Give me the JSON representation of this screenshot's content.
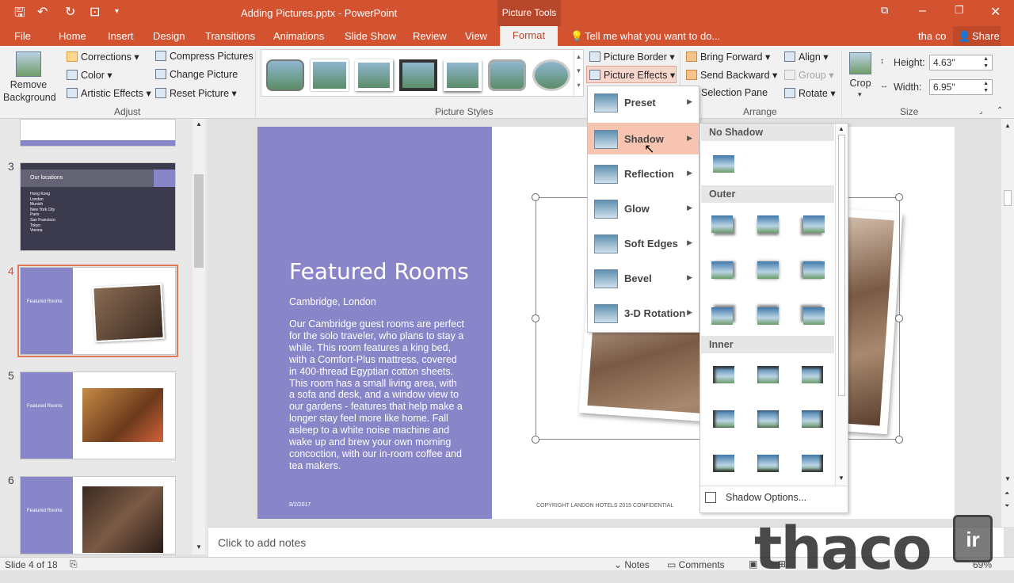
{
  "titlebar": {
    "title": "Adding Pictures.pptx - PowerPoint",
    "context": "Picture Tools"
  },
  "tabs": {
    "file": "File",
    "home": "Home",
    "insert": "Insert",
    "design": "Design",
    "transitions": "Transitions",
    "animations": "Animations",
    "slideshow": "Slide Show",
    "review": "Review",
    "view": "View",
    "format": "Format",
    "tellme": "Tell me what you want to do...",
    "user": "tha co",
    "share": "Share"
  },
  "ribbon": {
    "remove_bg": "Remove Background",
    "corrections": "Corrections",
    "color": "Color",
    "artistic": "Artistic Effects",
    "compress": "Compress Pictures",
    "change": "Change Picture",
    "reset": "Reset Picture",
    "adjust": "Adjust",
    "border": "Picture Border",
    "effects": "Picture Effects",
    "styles": "Picture Styles",
    "bring_forward": "Bring Forward",
    "send_backward": "Send Backward",
    "selection_pane": "Selection Pane",
    "align": "Align",
    "group": "Group",
    "rotate": "Rotate",
    "arrange": "Arrange",
    "crop": "Crop",
    "height_label": "Height:",
    "height_value": "4.63\"",
    "width_label": "Width:",
    "width_value": "6.95\"",
    "size": "Size"
  },
  "effects_menu": [
    "Preset",
    "Shadow",
    "Reflection",
    "Glow",
    "Soft Edges",
    "Bevel",
    "3-D Rotation"
  ],
  "shadow_menu": {
    "no_shadow": "No Shadow",
    "outer": "Outer",
    "inner": "Inner",
    "options": "Shadow Options..."
  },
  "slides": [
    {
      "num": "3",
      "title": "Our locations",
      "items": [
        "Hong Kong",
        "London",
        "Munich",
        "New York City",
        "Paris",
        "San Francisco",
        "Tokyo",
        "Vienna"
      ]
    },
    {
      "num": "4",
      "title": "Featured Rooms"
    },
    {
      "num": "5",
      "title": "Featured Rooms"
    },
    {
      "num": "6",
      "title": "Featured Rooms"
    }
  ],
  "slide": {
    "title": "Featured Rooms",
    "subtitle": "Cambridge, London",
    "body": "Our Cambridge guest rooms are perfect for the solo traveler, who plans to stay a while. This room features a king bed, with a Comfort-Plus mattress, covered in 400-thread Egyptian cotton sheets. This room has a small living area, with a sofa and desk, and a window view to our gardens - features that help make a longer stay feel more like home. Fall asleep to a white noise machine and wake up and brew your own morning concoction, with our in-room coffee and tea makers.",
    "date": "8/2/2017",
    "footer": "COPYRIGHT LANDON HOTELS 2015 CONFIDENTIAL"
  },
  "notes_placeholder": "Click to add notes",
  "status": {
    "slide": "Slide 4 of 18",
    "notes": "Notes",
    "comments": "Comments",
    "zoom": "69%"
  },
  "watermark": {
    "text": "thaco",
    "suffix": "ir"
  }
}
